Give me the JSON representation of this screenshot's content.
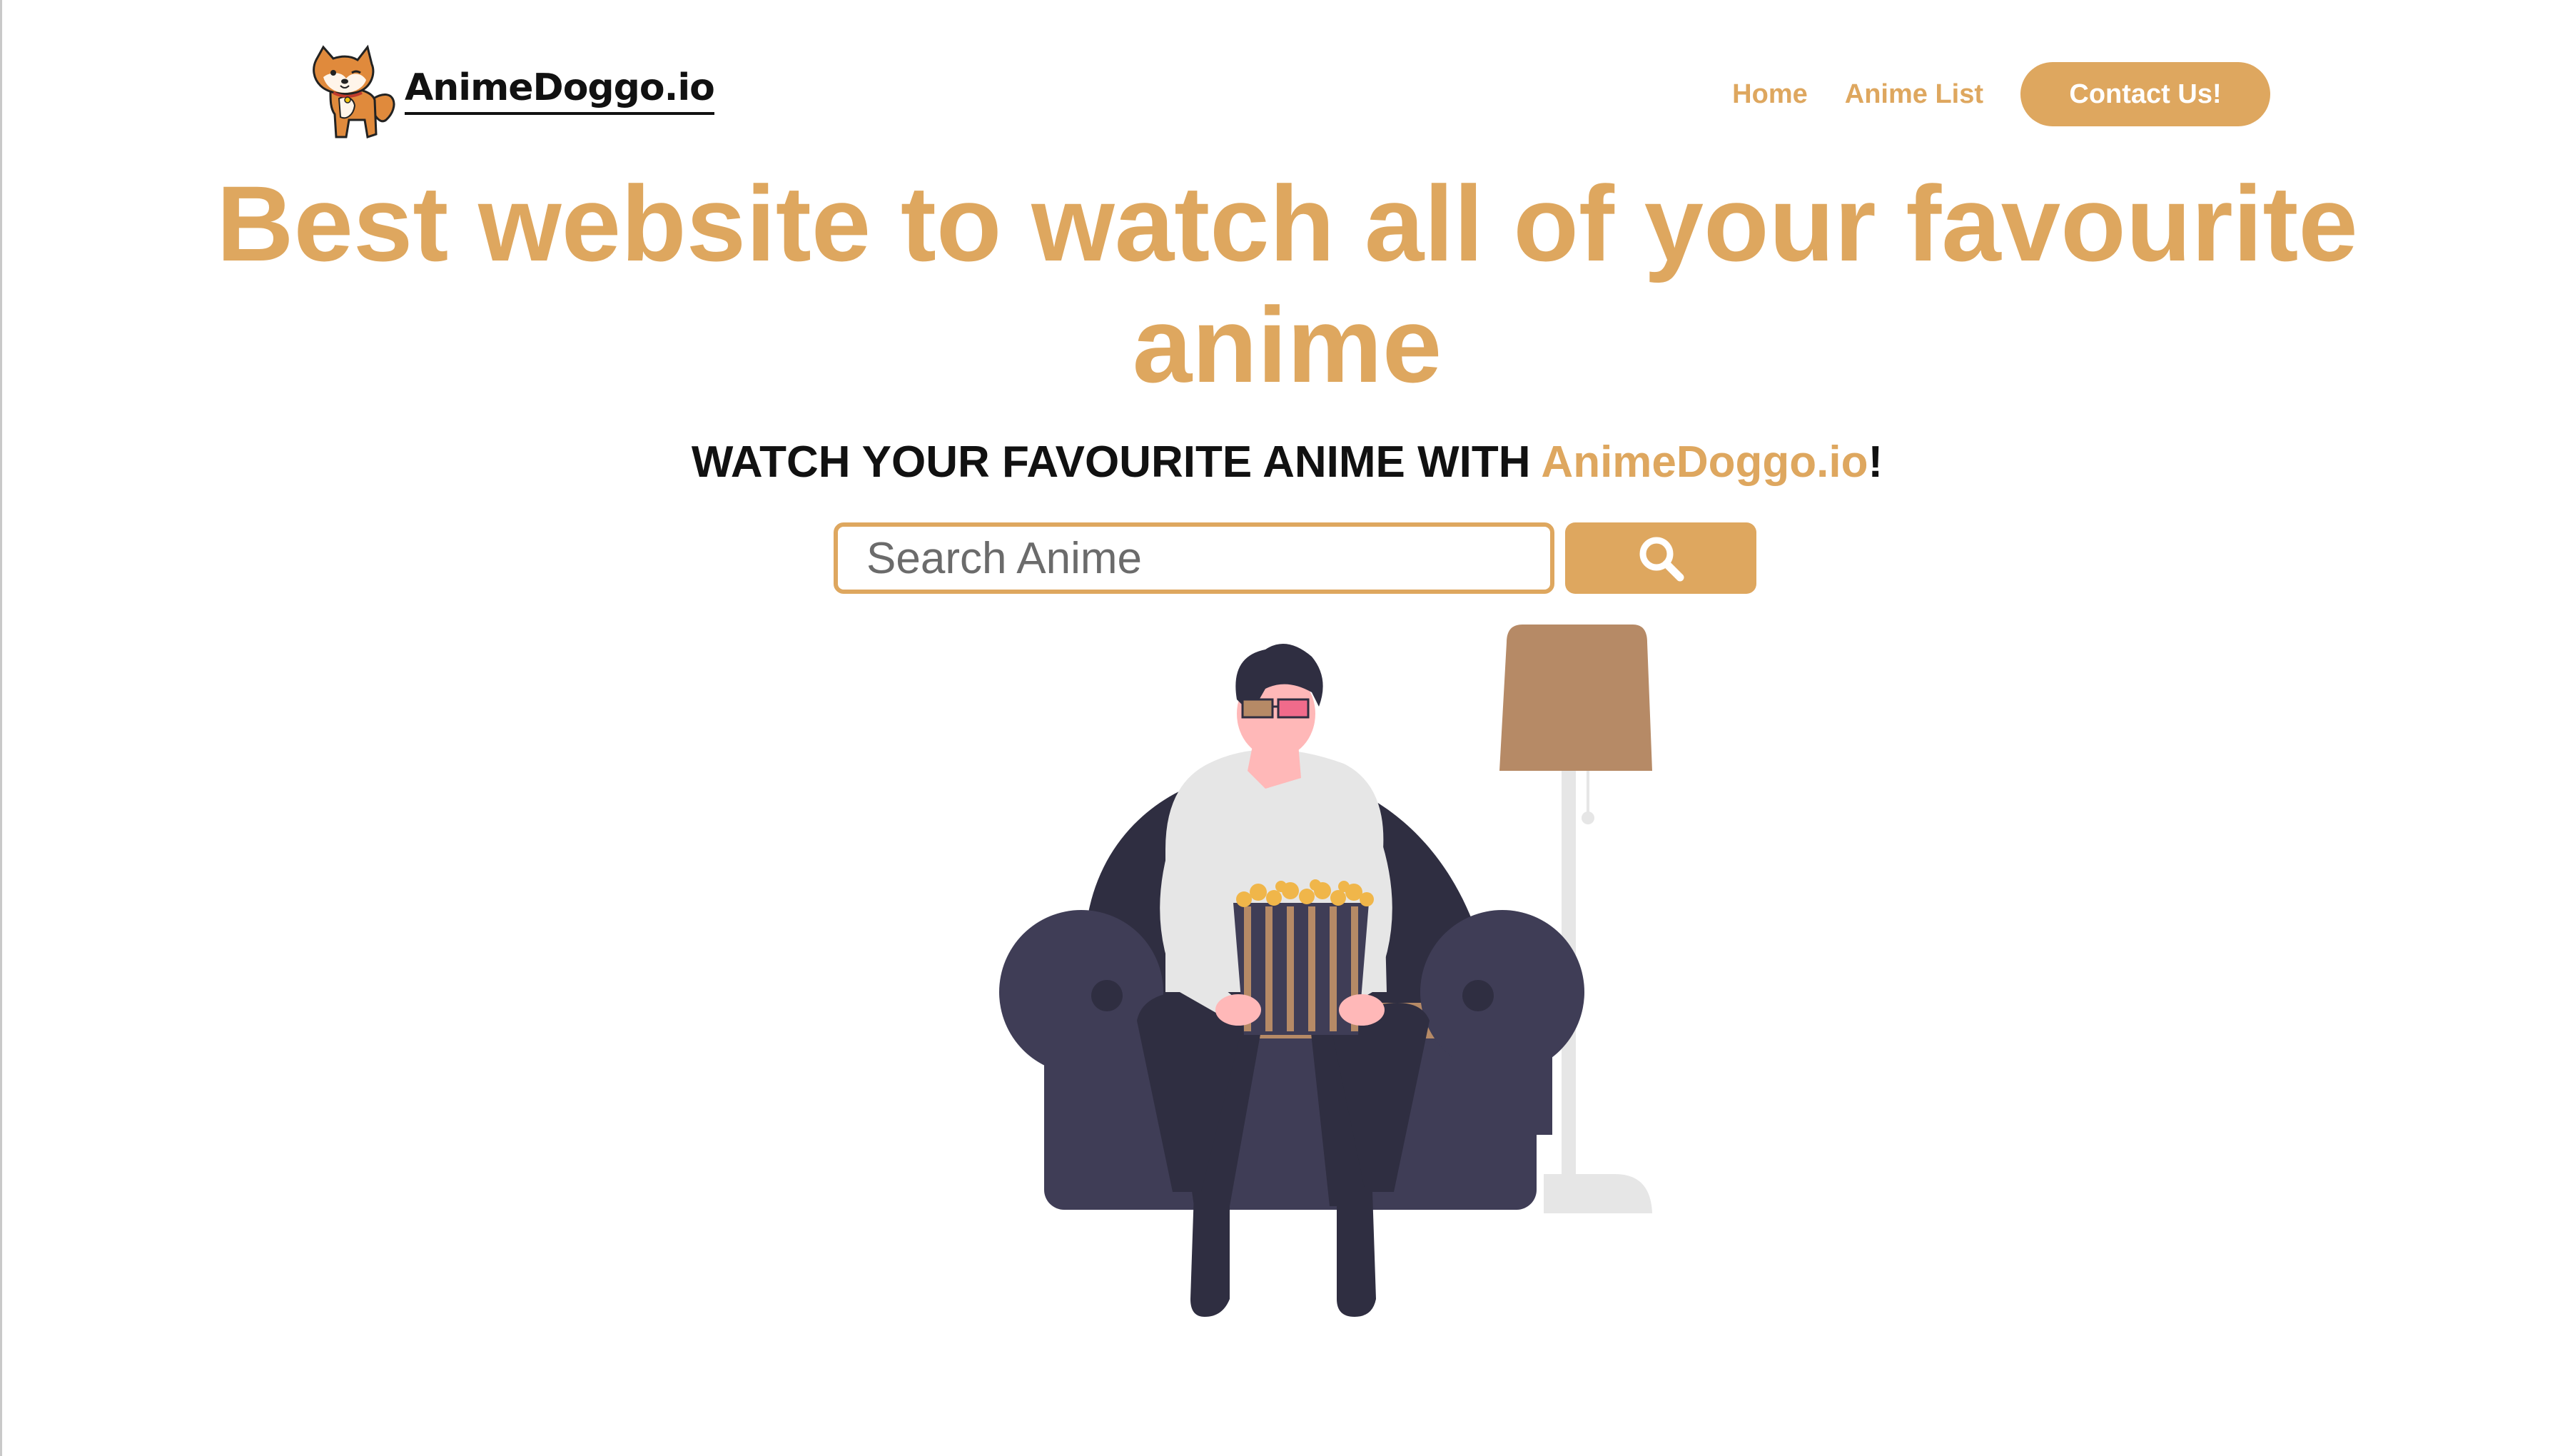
{
  "header": {
    "brand_name": "AnimeDoggo.io",
    "nav": {
      "home_label": "Home",
      "anime_list_label": "Anime List",
      "contact_label": "Contact Us!"
    }
  },
  "hero": {
    "title_line1": "Best website to watch all of your favourite",
    "title_line2": "anime",
    "tagline_prefix": "WATCH YOUR FAVOURITE ANIME WITH ",
    "tagline_brand": "AnimeDoggo.io",
    "tagline_suffix": "!"
  },
  "search": {
    "placeholder": "Search Anime",
    "value": "",
    "button_icon": "search-icon"
  },
  "illustration": {
    "subject": "person-on-armchair-with-popcorn-and-3d-glasses"
  },
  "colors": {
    "accent": "#dea75f",
    "text": "#111111",
    "background": "#ffffff",
    "sofa": "#3f3d56",
    "lamp_shade": "#b68a66"
  }
}
